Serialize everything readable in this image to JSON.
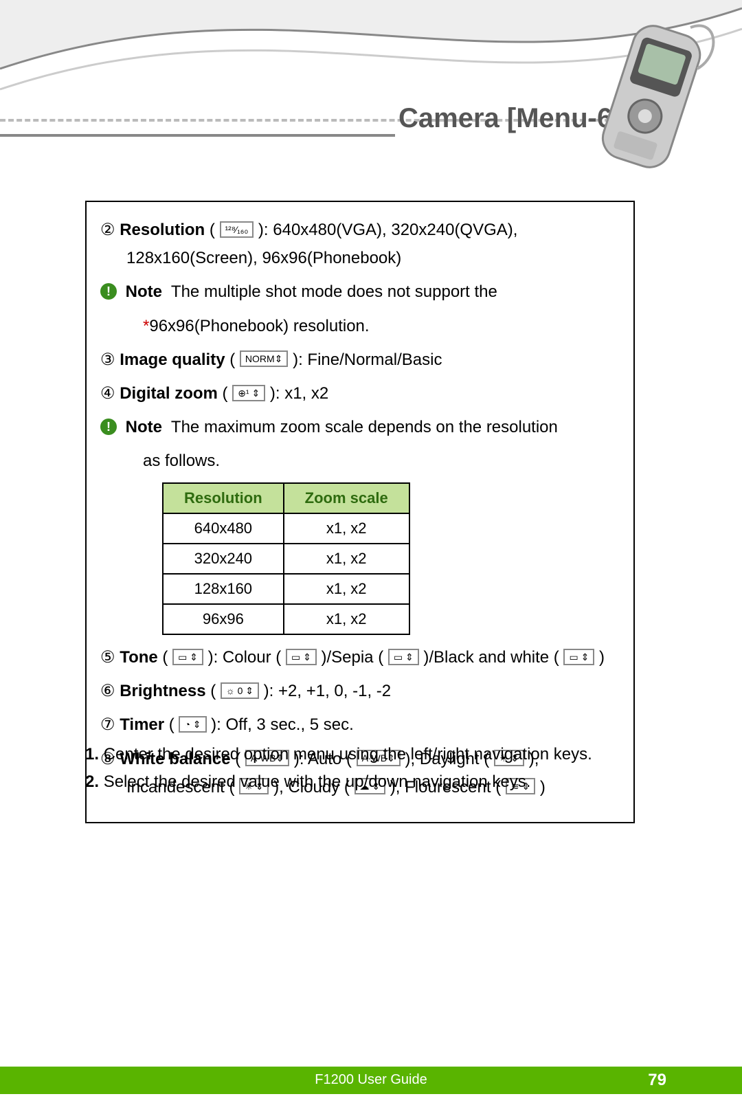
{
  "header": {
    "title": "Camera [Menu-6]"
  },
  "item2": {
    "num": "②",
    "label": "Resolution",
    "icon": "¹²⁸⁄₁₆₀",
    "values": "640x480(VGA), 320x240(QVGA),",
    "values2": "128x160(Screen), 96x96(Phonebook)"
  },
  "note2": {
    "label": "Note",
    "text1": "The multiple shot mode does not support the",
    "star": "*",
    "text2": "96x96(Phonebook) resolution."
  },
  "item3": {
    "num": "③",
    "label": "Image quality",
    "icon": "NORM⇕",
    "values": "Fine/Normal/Basic"
  },
  "item4": {
    "num": "④",
    "label": "Digital zoom",
    "icon": "⊕¹ ⇕",
    "values": "x1, x2"
  },
  "note4": {
    "label": "Note",
    "text1": "The maximum zoom scale depends on the resolution",
    "text2": "as follows."
  },
  "table": {
    "h1": "Resolution",
    "h2": "Zoom scale",
    "rows": [
      {
        "r": "640x480",
        "z": "x1, x2"
      },
      {
        "r": "320x240",
        "z": "x1, x2"
      },
      {
        "r": "128x160",
        "z": "x1, x2"
      },
      {
        "r": "96x96",
        "z": "x1, x2"
      }
    ]
  },
  "item5": {
    "num": "⑤",
    "label": "Tone",
    "icon": "▭ ⇕",
    "v_colour": "Colour",
    "i_colour": "▭ ⇕",
    "v_sepia": "Sepia",
    "i_sepia": "▭ ⇕",
    "v_bw": "Black and white",
    "i_bw": "▭ ⇕"
  },
  "item6": {
    "num": "⑥",
    "label": "Brightness",
    "icon": "☼ 0 ⇕",
    "values": "+2, +1, 0, -1, -2"
  },
  "item7": {
    "num": "⑦",
    "label": "Timer",
    "icon": "◔ ⇕",
    "values": "Off, 3 sec., 5 sec."
  },
  "item8": {
    "num": "⑧",
    "label": "White balance",
    "icon": "A·WB⇕",
    "v_auto": "Auto",
    "i_auto": "A·WB⇕",
    "v_day": "Daylight",
    "i_day": "☀ ⇕",
    "v_inc": "Incandescent",
    "i_inc": "✳ ⇕",
    "v_cloud": "Cloudy",
    "i_cloud": "☁ ⇕",
    "v_flour": "Flourescent",
    "i_flour": "≋ ⇕"
  },
  "instructions": {
    "s1n": "1.",
    "s1": "Center the desired option menu using the left/right navigation keys.",
    "s2n": "2.",
    "s2": "Select the desired value with the up/down navigation keys."
  },
  "footer": {
    "guide": "F1200 User Guide",
    "page": "79"
  }
}
